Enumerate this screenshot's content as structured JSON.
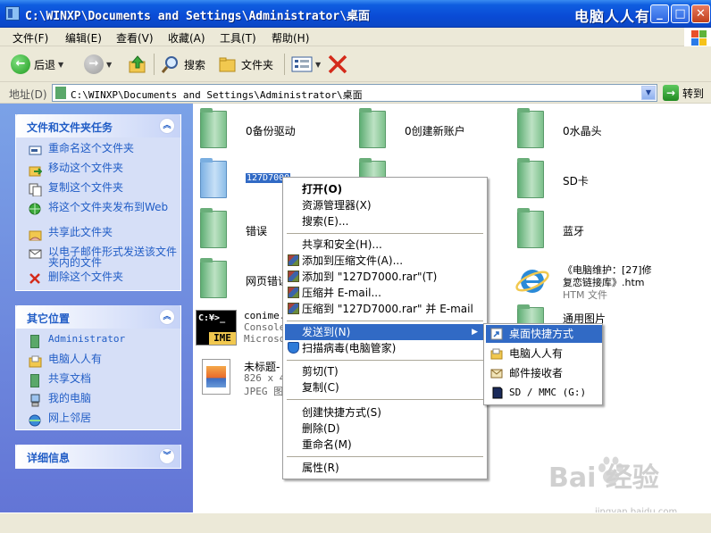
{
  "window": {
    "title": "C:\\WINXP\\Documents and Settings\\Administrator\\桌面",
    "brand": "电脑人人有",
    "minimize": "_",
    "maximize": "□",
    "close": "✕"
  },
  "menubar": [
    "文件(F)",
    "编辑(E)",
    "查看(V)",
    "收藏(A)",
    "工具(T)",
    "帮助(H)"
  ],
  "toolbar": {
    "back": "后退",
    "search": "搜索",
    "folders": "文件夹"
  },
  "address": {
    "label": "地址(D)",
    "path": "C:\\WINXP\\Documents and Settings\\Administrator\\桌面",
    "go": "转到"
  },
  "tasks_panel": {
    "title": "文件和文件夹任务",
    "items": [
      "重命名这个文件夹",
      "移动这个文件夹",
      "复制这个文件夹",
      "将这个文件夹发布到Web",
      "共享此文件夹",
      "以电子邮件形式发送该文件夹内的文件",
      "删除这个文件夹"
    ]
  },
  "other_places": {
    "title": "其它位置",
    "items": [
      "Administrator",
      "电脑人人有",
      "共享文档",
      "我的电脑",
      "网上邻居"
    ]
  },
  "details": {
    "title": "详细信息"
  },
  "files": {
    "f1": "0备份驱动",
    "f2": "0创建新账户",
    "f3": "0水晶头",
    "f4": "127D7000",
    "f5": "SD卡",
    "f6": "错误",
    "f7": "蓝牙",
    "f8": "网页错误",
    "f9_name": "《电脑维护：[27]修复恋链接库》.htm",
    "f9_name_l1": "《电脑维护：[27]修",
    "f9_name_l2": "复恋链接库》.htm",
    "f9_type": "HTM 文件",
    "f10": "通用图片",
    "conime_name": "conime.",
    "conime_l2": "Console",
    "conime_l3": "Microso",
    "img_name": "未标题-",
    "img_size": "826 x 4",
    "img_type": "JPEG 图"
  },
  "context_menu": {
    "open": "打开(O)",
    "explorer": "资源管理器(X)",
    "search": "搜索(E)...",
    "share": "共享和安全(H)...",
    "add_archive": "添加到压缩文件(A)...",
    "add_rar": "添加到 \"127D7000.rar\"(T)",
    "compress_email": "压缩并 E-mail...",
    "compress_rar_email": "压缩到 \"127D7000.rar\" 并 E-mail",
    "send_to": "发送到(N)",
    "scan": "扫描病毒(电脑管家)",
    "cut": "剪切(T)",
    "copy": "复制(C)",
    "shortcut": "创建快捷方式(S)",
    "delete": "删除(D)",
    "rename": "重命名(M)",
    "properties": "属性(R)",
    "arrow": "▶"
  },
  "send_to_menu": {
    "desktop": "桌面快捷方式",
    "diannao": "电脑人人有",
    "mail": "邮件接收者",
    "sd": "SD / MMC (G:)"
  },
  "watermark": {
    "main": "Bai  经验",
    "sub": "jingyan.baidu.com"
  }
}
